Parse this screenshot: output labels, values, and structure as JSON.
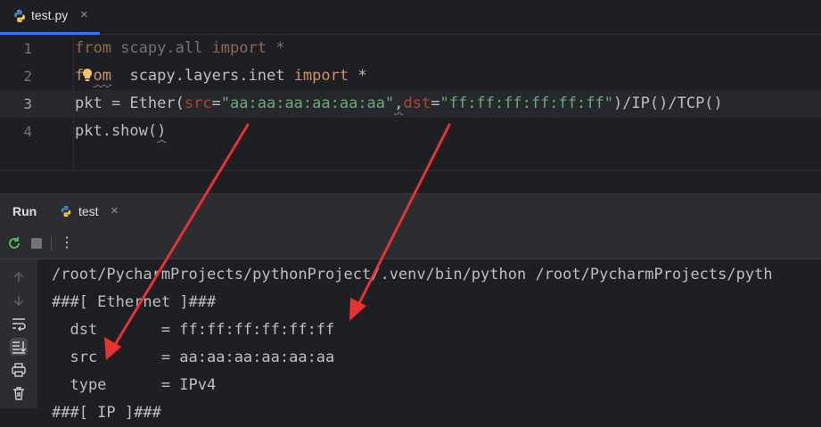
{
  "editor_tab": {
    "label": "test.py",
    "close": "×",
    "icon": "python-icon"
  },
  "code": [
    {
      "num": "1",
      "parts": [
        "from",
        " scapy.all ",
        "import",
        " *"
      ]
    },
    {
      "num": "2",
      "parts": [
        "f",
        "om",
        "  scapy.layers.inet ",
        "import",
        " *"
      ]
    },
    {
      "num": "3",
      "parts": [
        "pkt = Ether(",
        "src",
        "=",
        "\"aa:aa:aa:aa:aa:aa\"",
        ",",
        "dst",
        "=",
        "\"ff:ff:ff:ff:ff:ff\"",
        ")/IP()/TCP()"
      ]
    },
    {
      "num": "4",
      "parts": [
        "pkt.show(",
        ")"
      ]
    }
  ],
  "run_panel": {
    "title": "Run",
    "tab_label": "test",
    "tab_close": "×",
    "more": "⋮"
  },
  "console_lines": [
    "/root/PycharmProjects/pythonProject/.venv/bin/python /root/PycharmProjects/pyth",
    "###[ Ethernet ]###",
    "  dst       = ff:ff:ff:ff:ff:ff",
    "  src       = aa:aa:aa:aa:aa:aa",
    "  type      = IPv4",
    "###[ IP ]###"
  ],
  "icons": {
    "rerun": "rerun-icon",
    "stop": "stop-icon",
    "up": "arrow-up-icon",
    "down": "arrow-down-icon",
    "wrap": "soft-wrap-icon",
    "scroll": "scroll-to-end-icon",
    "print": "print-icon",
    "trash": "trash-icon",
    "bulb": "lightbulb-icon"
  },
  "colors": {
    "accent": "#3574f0",
    "keyword": "#cf8e6d",
    "string": "#6aab73",
    "param": "#aa4926",
    "arrow": "#e8322f",
    "background": "#1e1f22"
  }
}
